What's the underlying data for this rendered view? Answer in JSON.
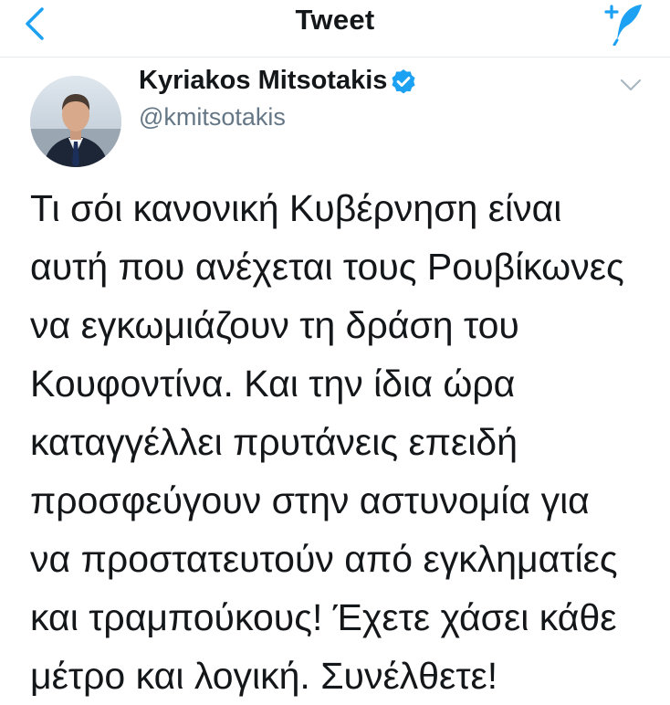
{
  "header": {
    "title": "Tweet",
    "back_icon": "chevron-left-icon",
    "compose_icon": "compose-tweet-icon",
    "accent_color": "#1da1f2"
  },
  "tweet": {
    "author": {
      "name": "Kyriakos Mitsotakis",
      "handle": "@kmitsotakis",
      "verified": true
    },
    "text_lines": [
      "Τι σόι κανονική Κυβέρνηση είναι",
      "αυτή που ανέχεται τους Ρουβίκωνες",
      "να εγκωμιάζουν τη δράση του",
      "Κουφοντίνα. Και την ίδια ώρα",
      "καταγγέλλει πρυτάνεις επειδή",
      "προσφεύγουν στην αστυνομία για",
      "να προστατευτούν από εγκληματίες",
      "και τραμπούκους! Έχετε χάσει κάθε",
      "μέτρο και λογική. Συνέλθετε!"
    ]
  }
}
